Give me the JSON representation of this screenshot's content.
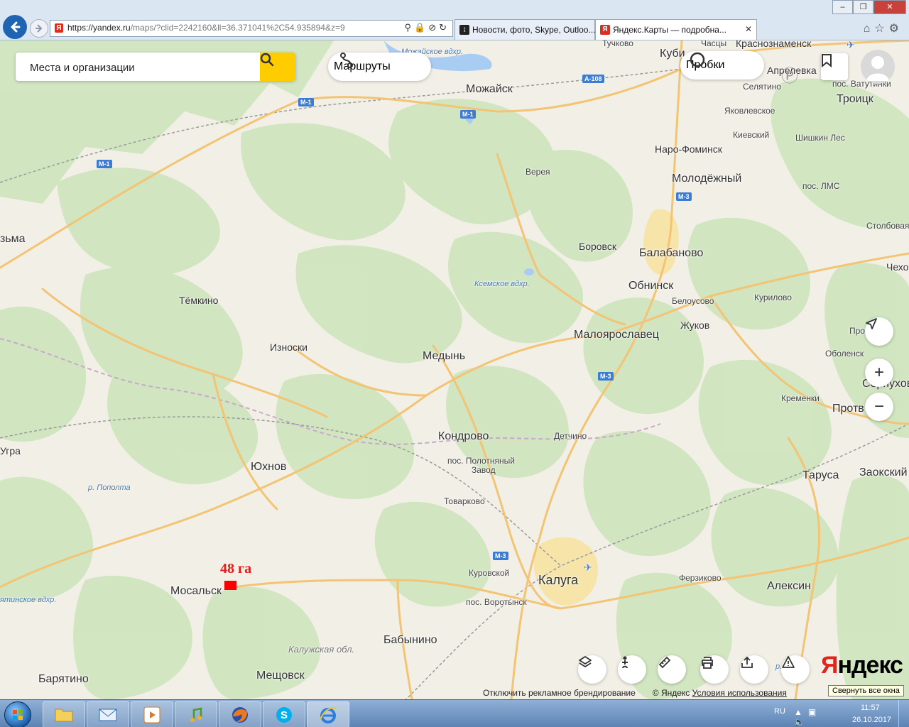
{
  "browser": {
    "url_main": "https://yandex.ru",
    "url_rest": "/maps/?clid=2242160&ll=36.371041%2C54.935894&z=9",
    "tabs": [
      {
        "label": "Новости, фото, Skype, Outloo...",
        "icon": "msn-icon"
      },
      {
        "label": "Яндекс.Карты — подробна...",
        "icon": "yandex-favicon"
      }
    ],
    "favicon_letter": "Я"
  },
  "map_ui": {
    "search_placeholder": "Места и организации",
    "routes_label": "Маршруты",
    "traffic_label": "Пробки",
    "logo_first": "Я",
    "logo_rest": "ндекс",
    "footer_ad": "Отключить рекламное брендирование",
    "footer_copyright": "© Яндекс",
    "footer_terms": "Условия использования",
    "tooltip": "Свернуть все окна"
  },
  "annotation": {
    "label": "48 га",
    "color": "#ff0000"
  },
  "places": {
    "mozhaysk": "Можайск",
    "chuchkovo": "Тучково",
    "kubinka": "Куби",
    "chastsy": "Часцы",
    "krasnoznamensk": "Краснознаменск",
    "aprelevka": "Апрелевка",
    "selyatino": "Селятино",
    "vatutinki": "пос. Ватутинки",
    "troitsk": "Троицк",
    "yakovlevskoe": "Яковлевское",
    "kievsky": "Киевский",
    "shishkin": "Шишкин Лес",
    "naro": "Наро-Фоминск",
    "vereya": "Верея",
    "molodezhny": "Молодёжный",
    "lms": "пос. ЛМС",
    "stolbovaya": "Столбовая",
    "vyazma": "зьма",
    "borovsk": "Боровск",
    "balabanovo": "Балабаново",
    "obninsk": "Обнинск",
    "chekhov": "Чехо",
    "temkino": "Тёмкино",
    "kosmskoe": "Ксемское вдхр.",
    "belousovo": "Белоусово",
    "kurilovo": "Курилово",
    "znoski": "Износки",
    "zhukov": "Жуков",
    "maloyaroslavets": "Малоярославец",
    "pro": "Про",
    "medyn": "Медынь",
    "obolensk": "Оболенск",
    "serpukhov": "Серпухов",
    "kremenki": "Кременки",
    "protvino": "Протв",
    "ugra": "Угра",
    "kondrovo": "Кондрово",
    "detchino": "Детчино",
    "polotnyany1": "пос. Полотняный",
    "polotnyany2": "Завод",
    "yukhnov": "Юхнов",
    "tarusa": "Таруса",
    "zaoksky": "Заокский",
    "popolta": "р. Пополта",
    "tovarkovo": "Товарково",
    "kurovskoy": "Куровской",
    "kaluga": "Калуга",
    "ferzikovo": "Ферзиково",
    "aleksin": "Алексин",
    "mosalsk": "Мосальск",
    "vorotynsk": "пос. Воротынск",
    "babynino": "Бабынино",
    "kaluzhskaya": "Калужская обл.",
    "baryatino": "Барятино",
    "meshchovsk": "Мещовск",
    "yatinskoe": "ятинское вдхр.",
    "mozhaiskoe": "Можайское вдхр.",
    "kr": "р. Кр"
  },
  "roads": {
    "m1a": "М-1",
    "m1b": "М-1",
    "m1c": "М-1",
    "a108": "А-108",
    "m3a": "М-3",
    "m3b": "М-3",
    "m3c": "М-3"
  },
  "taskbar": {
    "lang": "RU",
    "time": "11:57",
    "date": "26.10.2017"
  },
  "colors": {
    "forest": "#cfe5bf",
    "land": "#f2efe6",
    "road": "#f3c473",
    "yandex_yellow": "#ffcc00",
    "yandex_red": "#e0261b"
  }
}
